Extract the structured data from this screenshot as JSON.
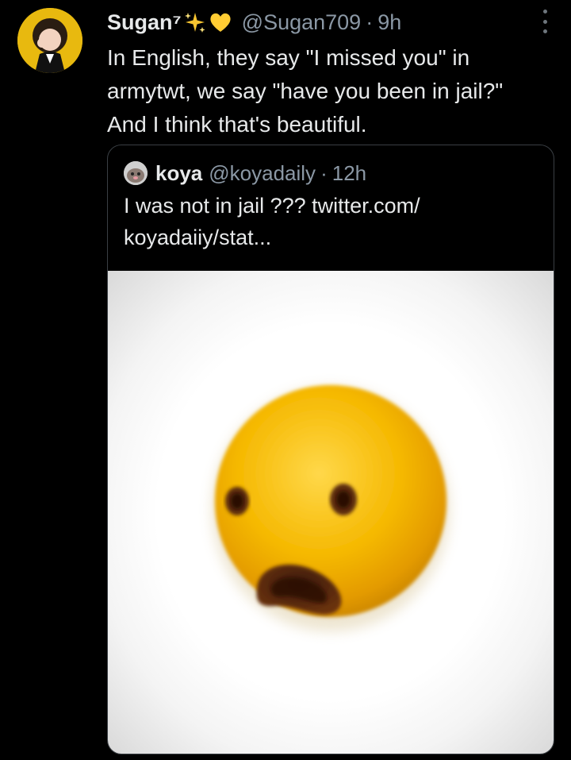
{
  "tweet": {
    "display_name": "Sugan⁷",
    "handle": "@Sugan709",
    "separator": "·",
    "time": "9h",
    "text": "In English, they say \"I missed you\" in\narmytwt, we say \"have you been in jail?\"\nAnd I think that's beautiful.",
    "icons": {
      "avatar": "avatar-photo",
      "name_emoji_1": "sparkles-icon",
      "name_emoji_2": "yellow-heart-icon",
      "more": "more-icon"
    }
  },
  "quote": {
    "display_name": "koya",
    "handle": "@koyadaily",
    "separator": "·",
    "time": "12h",
    "text": "I was not in jail ??? twitter.com/\nkoyadaiiy/stat...",
    "media": {
      "description_icon": "shocked-face-emoji-image"
    }
  },
  "colors": {
    "background": "#000000",
    "text_primary": "#e7e9ea",
    "text_secondary": "#8b98a5",
    "card_border": "#3a3f44",
    "emoji_yellow": "#f5b800",
    "heart_yellow": "#ffcc33"
  }
}
